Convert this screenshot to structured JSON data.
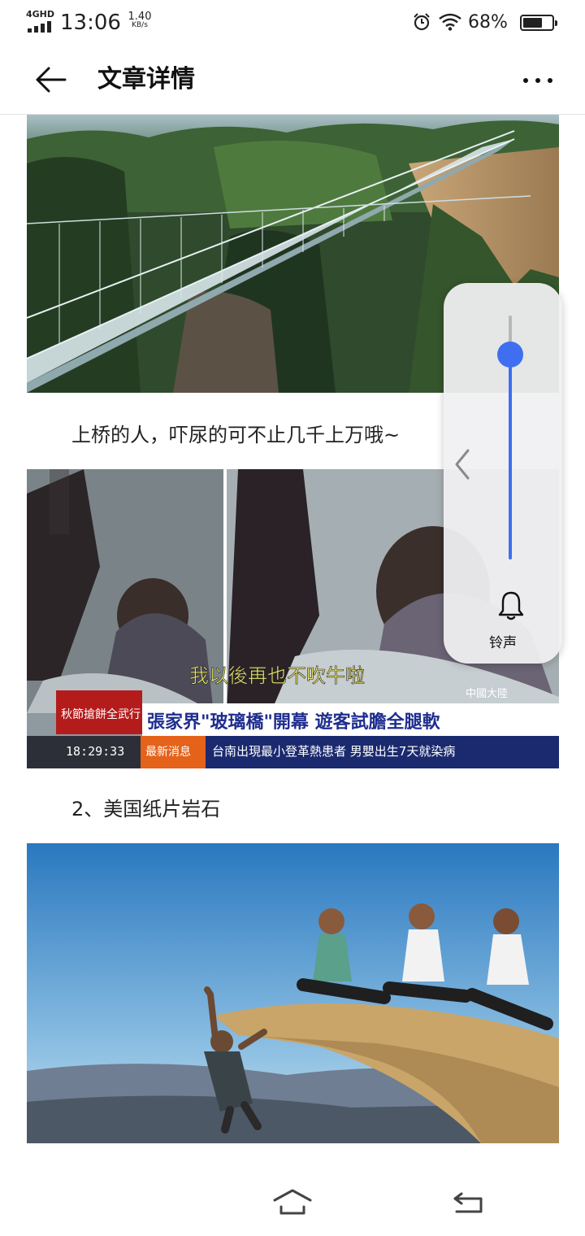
{
  "status_bar": {
    "network": "4GHD",
    "time": "13:06",
    "speed_value": "1.40",
    "speed_unit": "KB/s",
    "battery_percent": "68%",
    "battery_level": 0.68
  },
  "header": {
    "title": "文章详情"
  },
  "article": {
    "paragraph_1": "上桥的人，吓尿的可不止几千上万哦~",
    "paragraph_2": "2、美国纸片岩石",
    "caption_1": "我以後再也不吹牛啦",
    "caption_2": "張家界\"玻璃橋\"開幕 遊客試膽全腿軟",
    "caption_tag": "秋節搶餅全武行",
    "caption_time": "18:29:33",
    "caption_breaking": "最新消息",
    "caption_ticker": "台南出現最小登革熱患者 男嬰出生7天就染病",
    "caption_location": "中國大陸"
  },
  "volume_panel": {
    "level": 0.84,
    "ring_label": "铃声"
  },
  "colors": {
    "accent": "#3f6ff0",
    "text": "#222222"
  }
}
